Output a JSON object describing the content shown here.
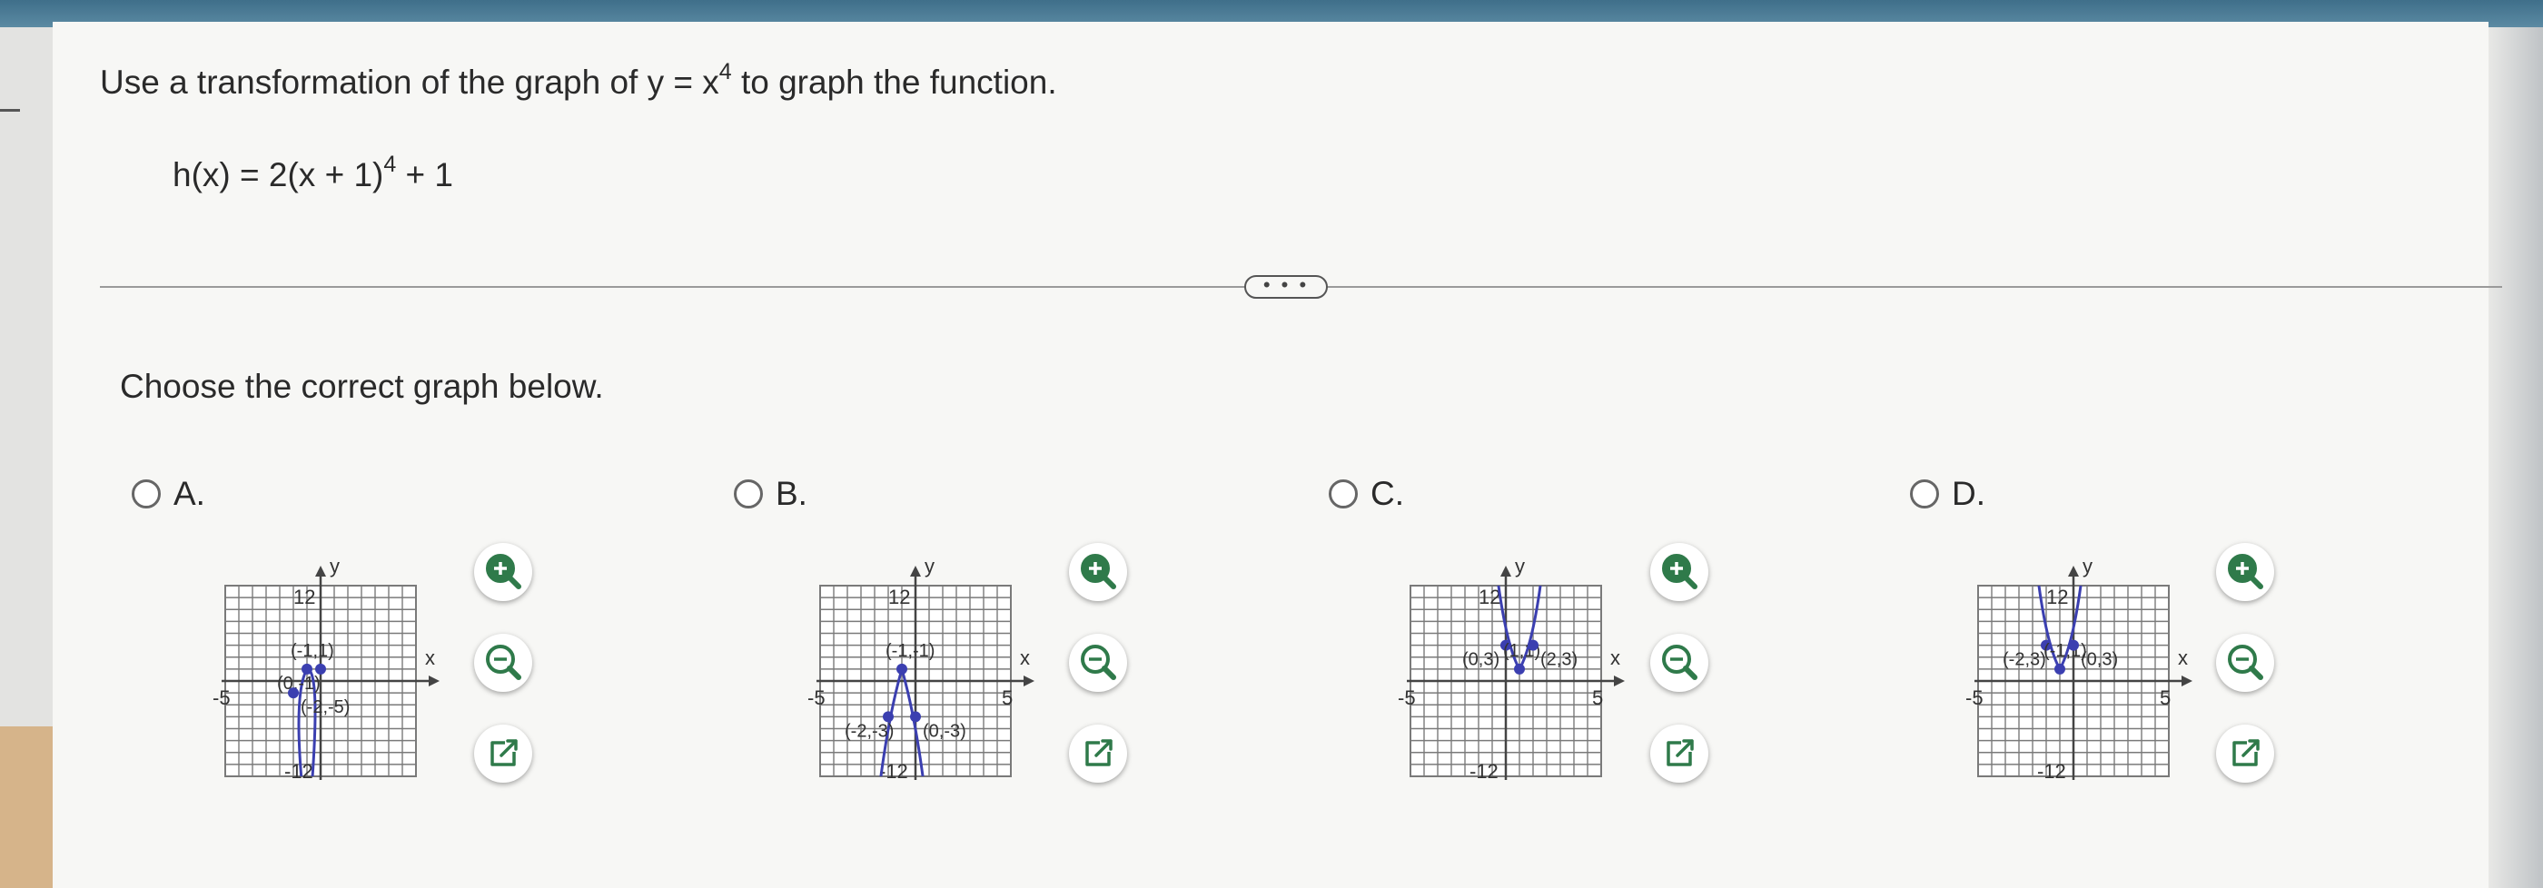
{
  "question": {
    "prompt_pre": "Use a transformation of the graph of y = x",
    "prompt_exp": "4",
    "prompt_post": " to graph the function.",
    "func_pre": "h(x) = 2(x + 1)",
    "func_exp": "4",
    "func_post": " + 1"
  },
  "more_button": "• • •",
  "choose_text": "Choose the correct graph below.",
  "options": [
    {
      "label": "A.",
      "graph": {
        "y_tick": "12",
        "y_tick_neg": "-12",
        "x_tick_neg": "-5",
        "x_tick_pos": "",
        "xlabel": "x",
        "ylabel": "y",
        "points": [
          {
            "x": 0,
            "y": 1,
            "label": "(0,-1)"
          },
          {
            "x": -1,
            "y": 1,
            "label": "(-1,1)"
          },
          {
            "x": -2,
            "y": -1,
            "label": "(-2,-5)"
          }
        ]
      }
    },
    {
      "label": "B.",
      "graph": {
        "y_tick": "12",
        "y_tick_neg": "-12",
        "x_tick_neg": "-5",
        "x_tick_pos": "5",
        "xlabel": "x",
        "ylabel": "y",
        "points": [
          {
            "x": -2,
            "y": -3,
            "label": "(-2,-3)"
          },
          {
            "x": -1,
            "y": 1,
            "label": "(-1,-1)"
          },
          {
            "x": 0,
            "y": -3,
            "label": "(0,-3)"
          }
        ]
      }
    },
    {
      "label": "C.",
      "graph": {
        "y_tick": "12",
        "y_tick_neg": "-12",
        "x_tick_neg": "-5",
        "x_tick_pos": "5",
        "xlabel": "x",
        "ylabel": "y",
        "points": [
          {
            "x": 0,
            "y": 3,
            "label": "(0,3)"
          },
          {
            "x": 1,
            "y": 1,
            "label": "(1,1)"
          },
          {
            "x": 2,
            "y": 3,
            "label": "(2,3)"
          }
        ]
      }
    },
    {
      "label": "D.",
      "graph": {
        "y_tick": "12",
        "y_tick_neg": "-12",
        "x_tick_neg": "-5",
        "x_tick_pos": "5",
        "xlabel": "x",
        "ylabel": "y",
        "points": [
          {
            "x": -2,
            "y": 3,
            "label": "(-2,3)"
          },
          {
            "x": -1,
            "y": 1,
            "label": "(-1,1)"
          },
          {
            "x": 0,
            "y": 3,
            "label": "(0,3)"
          }
        ]
      }
    }
  ],
  "tool_icons": [
    "zoom-in-icon",
    "zoom-out-icon",
    "open-new-window-icon"
  ],
  "colors": {
    "curve": "#3b3fb0",
    "point": "#3b3fb0",
    "grid": "#7a7a7a",
    "tool_icon": "#2f7a4a"
  }
}
